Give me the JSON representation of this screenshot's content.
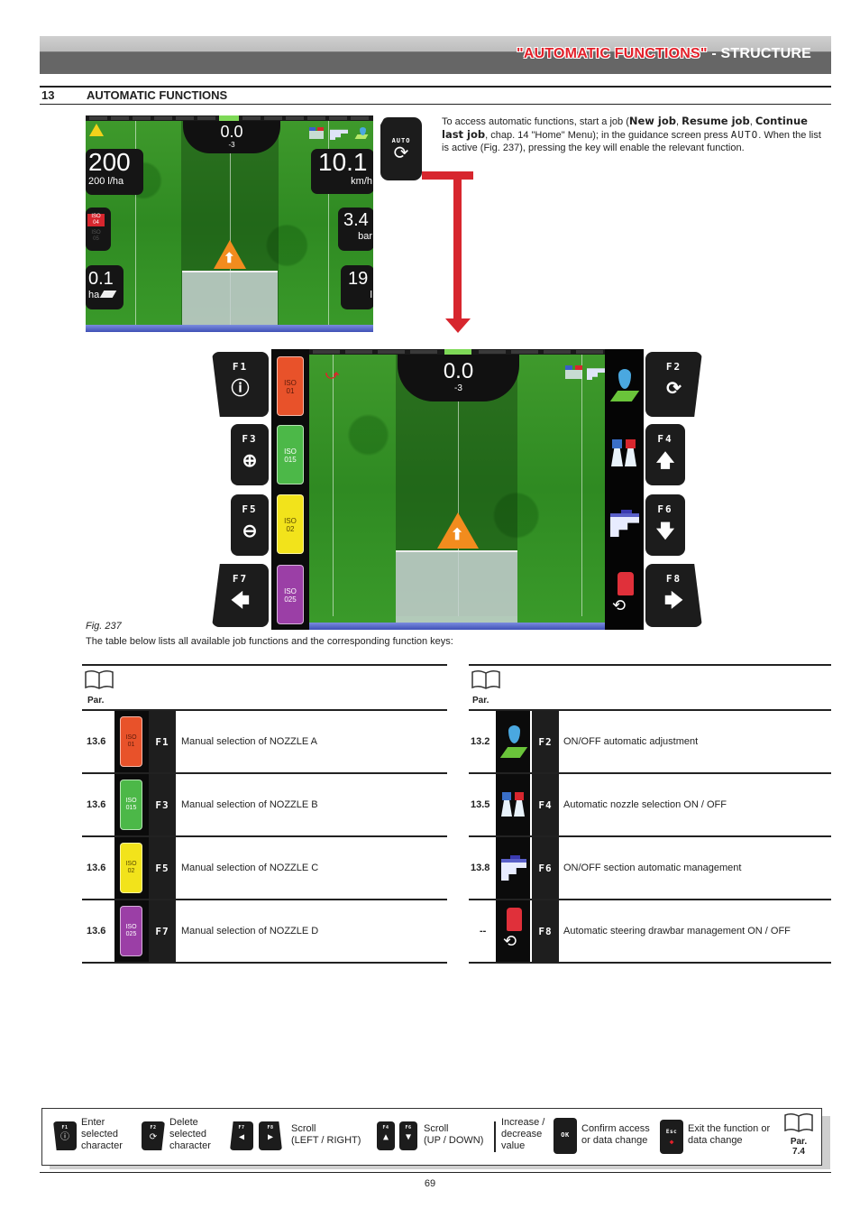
{
  "header": {
    "title_highlight": "\"AUTOMATIC FUNCTIONS\"",
    "title_rest": " - STRUCTURE"
  },
  "section": {
    "number": "13",
    "title": "AUTOMATIC FUNCTIONS"
  },
  "screen1": {
    "heading_value": "0.0",
    "heading_offset": "-3",
    "rate_value": "200",
    "rate_target": "200 l/ha",
    "iso_active": "ISO\n04",
    "iso_inactive": "ISO\n05",
    "area_value": "0.1",
    "area_unit": "ha",
    "speed_value": "10.1",
    "speed_unit": "km/h",
    "pressure_value": "3.4",
    "pressure_unit": "bar",
    "volume_value": "19",
    "volume_unit": "l",
    "icons": [
      "warning-icon",
      "nozzle-pair-icon",
      "boom-sections-icon",
      "drop-field-icon"
    ]
  },
  "auto_key": {
    "label": "AUTO",
    "icon": "refresh-icon"
  },
  "intro": {
    "part1": "To access automatic functions, start a job (",
    "b1": "New job",
    "sep1": ", ",
    "b2": "Resume job",
    "sep2": ", ",
    "b3": "Continue last job",
    "part2": ", chap. 14 \"Home\" Menu); in the guidance screen press ",
    "key": "AUTO",
    "part3": ". When the list is active (Fig. 237), pressing the key will enable the relevant function."
  },
  "screen2": {
    "heading_value": "0.0",
    "heading_offset": "-3",
    "iso_buttons": [
      {
        "line1": "ISO",
        "line2": "01",
        "color": "#e8522a",
        "text_color": "#5a1a0a"
      },
      {
        "line1": "ISO",
        "line2": "015",
        "color": "#4cb848",
        "text_color": "#ffffff"
      },
      {
        "line1": "ISO",
        "line2": "02",
        "color": "#f2e31b",
        "text_color": "#5a4a00"
      },
      {
        "line1": "ISO",
        "line2": "025",
        "color": "#9b3fa6",
        "text_color": "#ffffff"
      }
    ],
    "left_keys": [
      {
        "name": "F1",
        "symbol": "ⓘ",
        "icon": "info-icon"
      },
      {
        "name": "F3",
        "symbol": "⊕",
        "icon": "plus-circle-icon"
      },
      {
        "name": "F5",
        "symbol": "⊖",
        "icon": "minus-circle-icon"
      },
      {
        "name": "F7",
        "symbol": "🡄",
        "icon": "arrow-left-icon"
      }
    ],
    "right_keys": [
      {
        "name": "F2",
        "symbol": "⟳",
        "icon": "refresh-icon"
      },
      {
        "name": "F4",
        "symbol": "🡅",
        "icon": "arrow-up-icon"
      },
      {
        "name": "F6",
        "symbol": "🡇",
        "icon": "arrow-down-icon"
      },
      {
        "name": "F8",
        "symbol": "🡆",
        "icon": "arrow-right-icon"
      }
    ]
  },
  "figure": {
    "caption": "Fig. 237",
    "table_intro": "The table below lists all available job functions and the corresponding function keys:"
  },
  "tables": {
    "par_header": "Par.",
    "left": [
      {
        "par": "13.6",
        "key": "F1",
        "desc": "Manual selection of NOZZLE A",
        "iso": "ISO\n01",
        "color": "#e8522a",
        "text_color": "#5a1a0a"
      },
      {
        "par": "13.6",
        "key": "F3",
        "desc": "Manual selection of NOZZLE B",
        "iso": "ISO\n015",
        "color": "#4cb848",
        "text_color": "#ffffff"
      },
      {
        "par": "13.6",
        "key": "F5",
        "desc": "Manual selection of NOZZLE C",
        "iso": "ISO\n02",
        "color": "#f2e31b",
        "text_color": "#5a4a00"
      },
      {
        "par": "13.6",
        "key": "F7",
        "desc": "Manual selection of NOZZLE D",
        "iso": "ISO\n025",
        "color": "#9b3fa6",
        "text_color": "#ffffff"
      }
    ],
    "right": [
      {
        "par": "13.2",
        "key": "F2",
        "desc": "ON/OFF automatic adjustment",
        "icon": "drop-field-icon"
      },
      {
        "par": "13.5",
        "key": "F4",
        "desc": "Automatic nozzle selection ON / OFF",
        "icon": "nozzle-pair-icon"
      },
      {
        "par": "13.8",
        "key": "F6",
        "desc": "ON/OFF section automatic management",
        "icon": "boom-sections-icon"
      },
      {
        "par": "--",
        "key": "F8",
        "desc": "Automatic steering drawbar management ON / OFF",
        "icon": "steering-drawbar-icon"
      }
    ]
  },
  "legend": {
    "items": [
      {
        "keys": [
          "F1"
        ],
        "text": "Enter\nselected\ncharacter"
      },
      {
        "keys": [
          "F2"
        ],
        "text": "Delete\nselected\ncharacter"
      },
      {
        "keys": [
          "F7",
          "F8"
        ],
        "text": "Scroll\n(LEFT / RIGHT)"
      },
      {
        "keys": [
          "F4",
          "F6"
        ],
        "text": "Scroll\n(UP / DOWN)"
      },
      {
        "keys": [],
        "text": "Increase /\ndecrease\nvalue"
      },
      {
        "keys": [
          "OK"
        ],
        "text": "Confirm access\nor data change"
      },
      {
        "keys": [
          "Esc"
        ],
        "text": "Exit the function or\ndata change"
      }
    ],
    "par_label": "Par.",
    "par_value": "7.4"
  },
  "page_number": "69"
}
